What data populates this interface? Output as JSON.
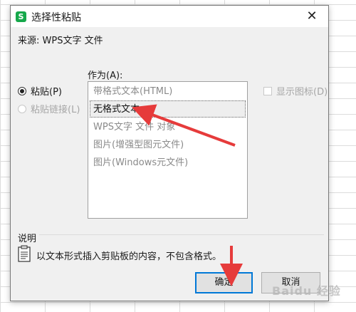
{
  "dialog": {
    "title": "选择性粘贴",
    "close_glyph": "✕",
    "source_line": "来源: WPS文字 文件",
    "as_label": "作为(A):",
    "options": {
      "paste_label": "粘贴(P)",
      "paste_link_label": "粘贴链接(L)"
    },
    "list_items": [
      "带格式文本(HTML)",
      "无格式文本",
      "WPS文字 文件 对象",
      "图片(增强型图元文件)",
      "图片(Windows元文件)"
    ],
    "selected_index": 1,
    "display_icon_label": "显示图标(D)",
    "description": {
      "heading": "说明",
      "text": "以文本形式插入剪贴板的内容，不包含格式。"
    },
    "buttons": {
      "ok": "确定",
      "cancel": "取消"
    }
  },
  "watermark": "Baidu 经验",
  "colors": {
    "app_icon": "#16a84b",
    "arrow": "#e63b3b",
    "ok_border": "#0078d7"
  },
  "icons": {
    "app": "wps-spreadsheet-icon",
    "close": "close-icon",
    "clipboard": "clipboard-icon"
  }
}
